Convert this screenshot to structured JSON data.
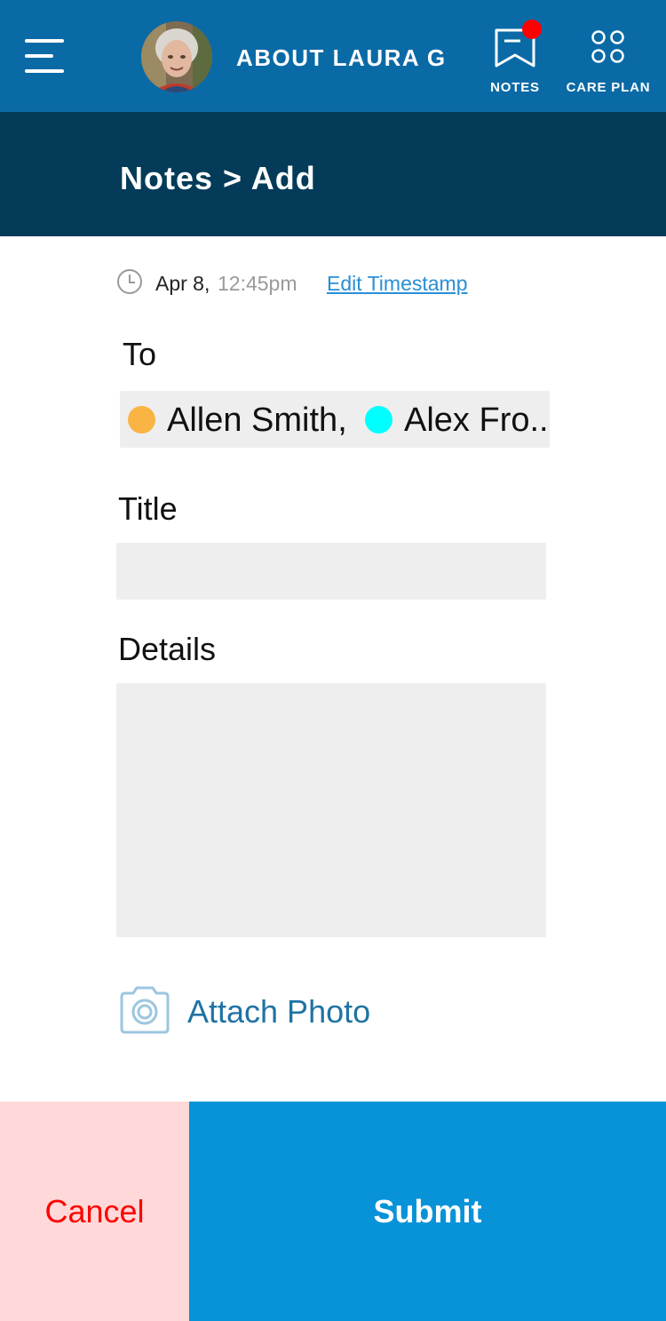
{
  "header": {
    "title": "ABOUT LAURA G",
    "notes_label": "NOTES",
    "care_plan_label": "CARE PLAN",
    "notes_has_unread": true
  },
  "subheader": {
    "breadcrumb": "Notes > Add"
  },
  "timestamp": {
    "date": "Apr 8,",
    "time": "12:45pm",
    "edit_label": "Edit Timestamp"
  },
  "form": {
    "to_label": "To",
    "recipients": [
      {
        "name": "Allen Smith,",
        "color": "#f9b443"
      },
      {
        "name": "Alex Fro..",
        "color": "#00ffff"
      }
    ],
    "title_label": "Title",
    "title_value": "",
    "details_label": "Details",
    "details_value": "",
    "attach_label": "Attach Photo"
  },
  "actions": {
    "cancel_label": "Cancel",
    "submit_label": "Submit"
  },
  "colors": {
    "topbar": "#0a6aa6",
    "subbar": "#043b59",
    "accent": "#0893d8",
    "cancel_bg": "#ffd9d9",
    "cancel_text": "#ff0000",
    "badge": "#ff0000"
  }
}
